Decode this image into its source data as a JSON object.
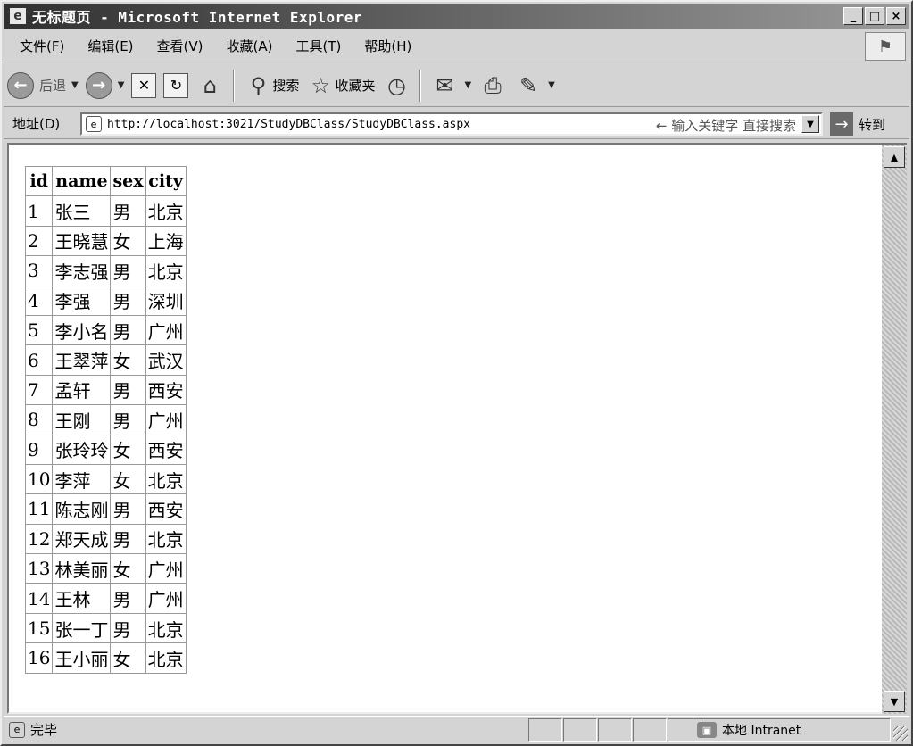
{
  "window": {
    "title": "无标题页 - Microsoft Internet Explorer",
    "icon": "ie-page-icon",
    "controls": {
      "minimize": "_",
      "maximize": "□",
      "close": "×"
    }
  },
  "menu": [
    "文件(F)",
    "编辑(E)",
    "查看(V)",
    "收藏(A)",
    "工具(T)",
    "帮助(H)"
  ],
  "toolbar": {
    "back_label": "后退",
    "search_label": "搜索",
    "favorites_label": "收藏夹"
  },
  "address": {
    "label": "地址(D)",
    "url": "http://localhost:3021/StudyDBClass/StudyDBClass.aspx",
    "search_hint": "← 输入关键字 直接搜索",
    "go_label": "转到"
  },
  "table": {
    "headers": [
      "id",
      "name",
      "sex",
      "city"
    ],
    "rows": [
      [
        "1",
        "张三",
        "男",
        "北京"
      ],
      [
        "2",
        "王晓慧",
        "女",
        "上海"
      ],
      [
        "3",
        "李志强",
        "男",
        "北京"
      ],
      [
        "4",
        "李强",
        "男",
        "深圳"
      ],
      [
        "5",
        "李小名",
        "男",
        "广州"
      ],
      [
        "6",
        "王翠萍",
        "女",
        "武汉"
      ],
      [
        "7",
        "孟轩",
        "男",
        "西安"
      ],
      [
        "8",
        "王刚",
        "男",
        "广州"
      ],
      [
        "9",
        "张玲玲",
        "女",
        "西安"
      ],
      [
        "10",
        "李萍",
        "女",
        "北京"
      ],
      [
        "11",
        "陈志刚",
        "男",
        "西安"
      ],
      [
        "12",
        "郑天成",
        "男",
        "北京"
      ],
      [
        "13",
        "林美丽",
        "女",
        "广州"
      ],
      [
        "14",
        "王林",
        "男",
        "广州"
      ],
      [
        "15",
        "张一丁",
        "男",
        "北京"
      ],
      [
        "16",
        "王小丽",
        "女",
        "北京"
      ]
    ]
  },
  "status": {
    "text": "完毕",
    "zone": "本地 Intranet"
  }
}
